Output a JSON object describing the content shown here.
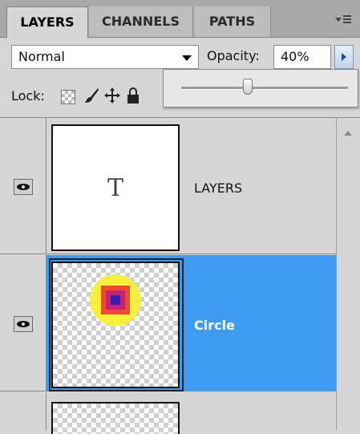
{
  "tabs": [
    {
      "label": "LAYERS",
      "active": true
    },
    {
      "label": "CHANNELS",
      "active": false
    },
    {
      "label": "PATHS",
      "active": false
    }
  ],
  "blend_mode": {
    "value": "Normal"
  },
  "opacity": {
    "label": "Opacity:",
    "value": "40%",
    "slider_fraction": 0.4
  },
  "lock": {
    "label": "Lock:"
  },
  "layers": [
    {
      "name": "LAYERS",
      "type": "text",
      "thumb_glyph": "T",
      "visible": true,
      "selected": false
    },
    {
      "name": "Circle",
      "type": "raster",
      "visible": true,
      "selected": true
    }
  ],
  "colors": {
    "selection": "#3e9cf0",
    "panel_bg": "#d6d6d6",
    "circle_outer": "#f7f03b",
    "circle_mid": "#f04a2c",
    "circle_inner": "#3b1bb0"
  },
  "icons": [
    "panel-menu-icon",
    "dropdown-caret-icon",
    "flyout-arrow-icon",
    "lock-transparent-icon",
    "lock-brush-icon",
    "lock-move-icon",
    "lock-all-icon",
    "eye-icon",
    "scroll-up-icon"
  ]
}
